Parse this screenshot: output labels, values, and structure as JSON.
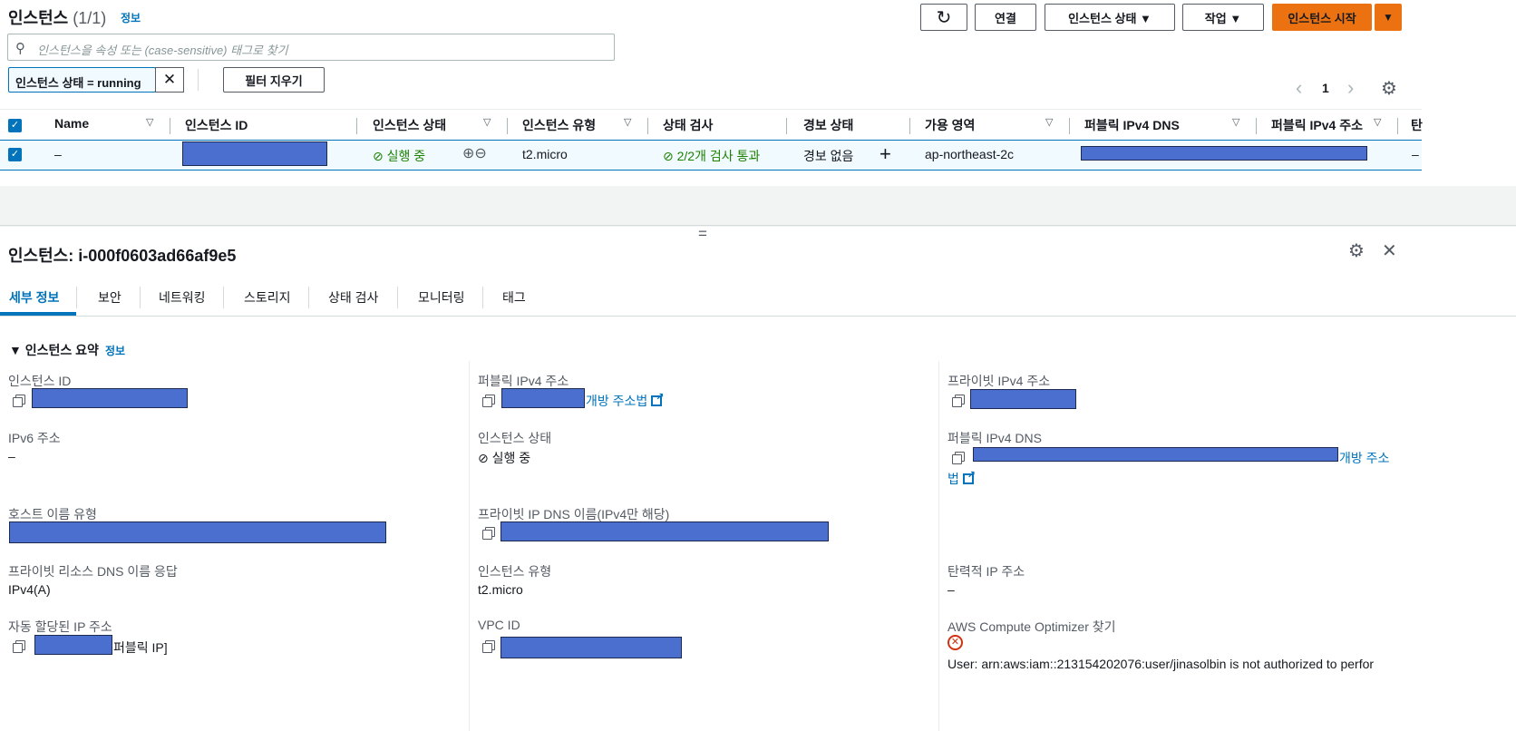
{
  "header": {
    "title": "인스턴스",
    "count": "(1/1)",
    "info": "정보"
  },
  "toolbar": {
    "refresh": "↻",
    "connect": "연결",
    "state": "인스턴스 상태 ▼",
    "actions": "작업 ▼",
    "launch": "인스턴스 시작",
    "launch_caret": "▼"
  },
  "search": {
    "placeholder": "인스턴스을 속성 또는 (case-sensitive) 태그로 찾기"
  },
  "filter": {
    "chip": "인스턴스 상태 = running",
    "clear": "필터 지우기",
    "chip_close": "✕"
  },
  "pagination": {
    "prev": "‹",
    "page": "1",
    "next": "›"
  },
  "table": {
    "headers": [
      "Name",
      "인스턴스 ID",
      "인스턴스 상태",
      "인스턴스 유형",
      "상태 검사",
      "경보 상태",
      "가용 영역",
      "퍼블릭 IPv4 DNS",
      "퍼블릭 IPv4 주소",
      "탄"
    ],
    "row": {
      "name": "–",
      "state": "실행 중",
      "type": "t2.micro",
      "check": "2/2개 검사 통과",
      "alarm": "경보 없음",
      "plus": "+",
      "az": "ap-northeast-2c",
      "last": "–"
    }
  },
  "divider": "=",
  "detail": {
    "title": "인스턴스: i-000f0603ad66af9e5",
    "tabs": [
      "세부 정보",
      "보안",
      "네트워킹",
      "스토리지",
      "상태 검사",
      "모니터링",
      "태그"
    ],
    "section": "인스턴스 요약",
    "section_info": "정보",
    "fields": {
      "instance_id": "인스턴스 ID",
      "public_ip": "퍼블릭 IPv4 주소",
      "public_ip_link": "개방 주소법",
      "private_ip": "프라이빗 IPv4 주소",
      "ipv6": "IPv6 주소",
      "ipv6_val": "–",
      "state": "인스턴스 상태",
      "state_val": "실행 중",
      "public_dns": "퍼블릭 IPv4 DNS",
      "public_dns_link1": "개방 주소",
      "public_dns_link2": "법",
      "hostname": "호스트 이름 유형",
      "private_dns": "프라이빗 IP DNS 이름(IPv4만 해당)",
      "resource_dns": "프라이빗 리소스 DNS 이름 응답",
      "resource_dns_val": "IPv4(A)",
      "itype": "인스턴스 유형",
      "itype_val": "t2.micro",
      "elastic": "탄력적 IP 주소",
      "elastic_val": "–",
      "auto_ip": "자동 할당된 IP 주소",
      "auto_ip_suffix": "퍼블릭 IP]",
      "vpc": "VPC ID",
      "optimizer": "AWS Compute Optimizer 찾기",
      "optimizer_err": "User: arn:aws:iam::213154202076:user/jinasolbin is not authorized to perfor"
    }
  }
}
